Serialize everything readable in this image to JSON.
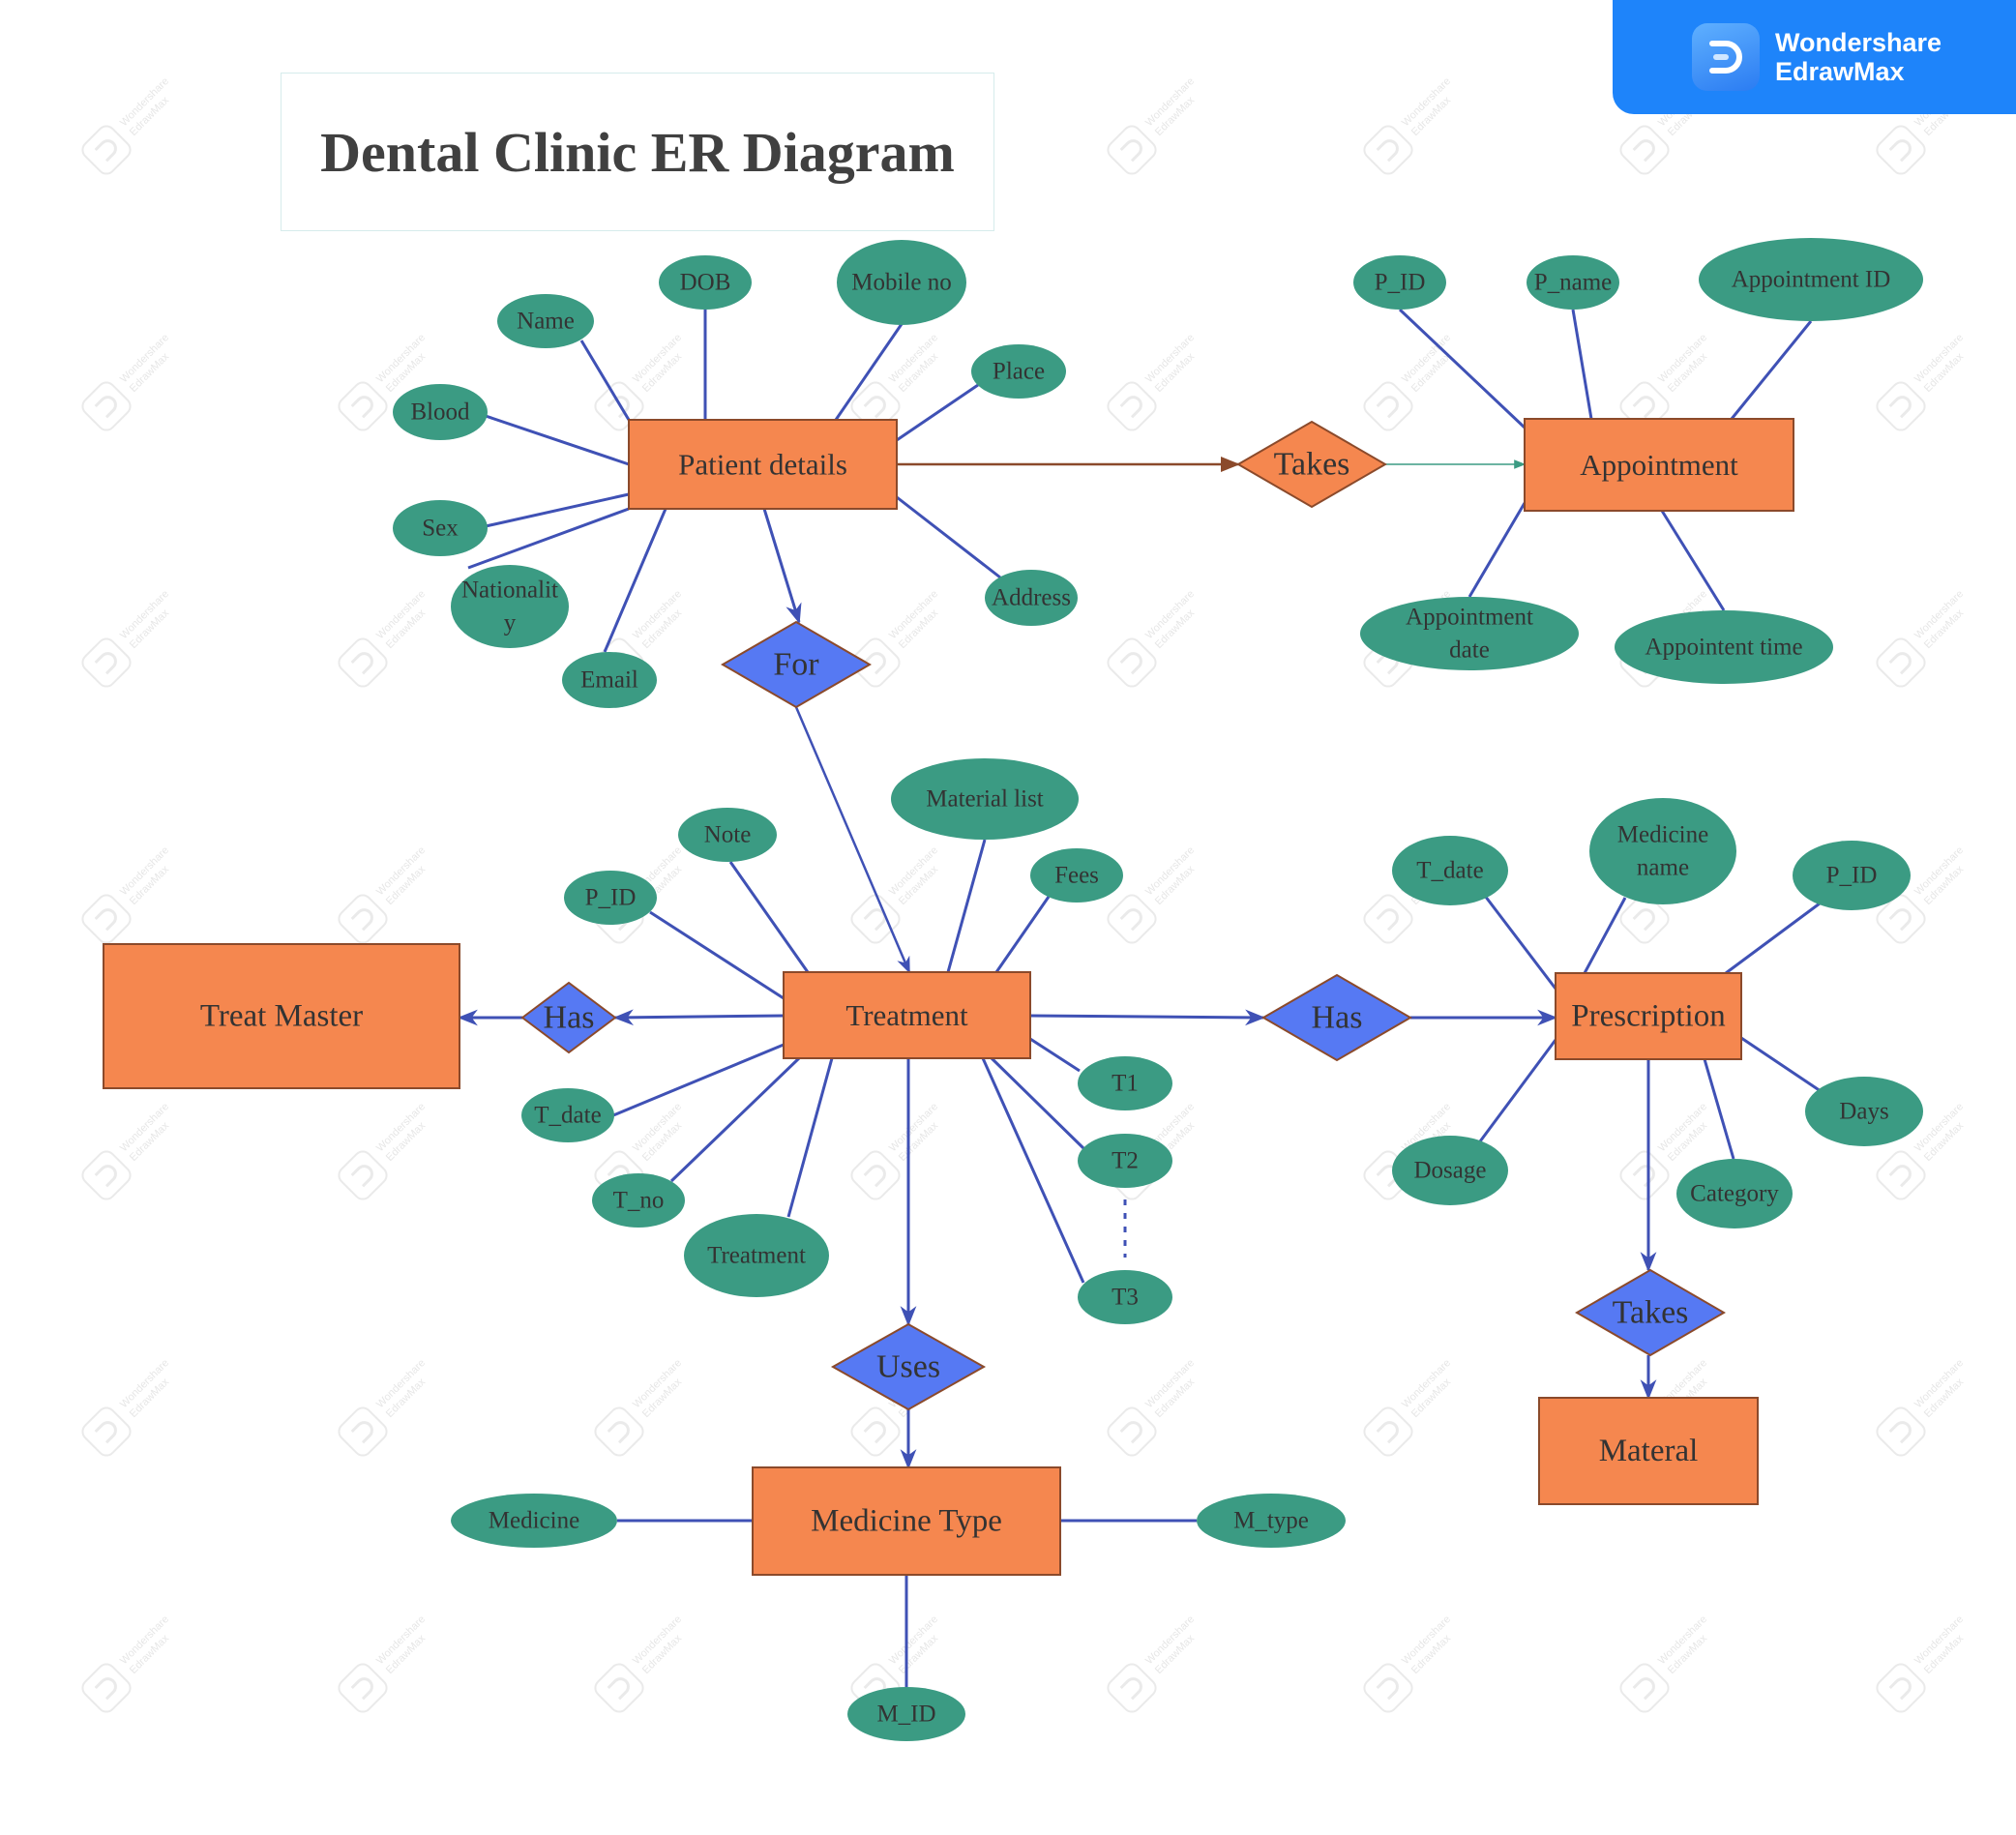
{
  "title": "Dental Clinic ER Diagram",
  "brand": {
    "line1": "Wondershare",
    "line2": "EdrawMax",
    "icon": "edrawmax-logo-icon",
    "watermark_line1": "Wondershare",
    "watermark_line2": "EdrawMax"
  },
  "colors": {
    "entity_fill": "#f5874f",
    "entity_stroke": "#8b4a2b",
    "attribute_fill": "#3b9b83",
    "relationship_fill": "#5679f3",
    "relationship_alt_fill": "#f5874f",
    "connector": "#3f51b5",
    "text": "#333333",
    "brand_bg": "#1e84fa"
  },
  "entities": [
    {
      "id": "patient",
      "label": "Patient details"
    },
    {
      "id": "appointment",
      "label": "Appointment"
    },
    {
      "id": "treatment",
      "label": "Treatment"
    },
    {
      "id": "treatmaster",
      "label": "Treat Master"
    },
    {
      "id": "prescription",
      "label": "Prescription"
    },
    {
      "id": "material",
      "label": "Materal"
    },
    {
      "id": "medtype",
      "label": "Medicine Type"
    }
  ],
  "relationships": [
    {
      "id": "takes1",
      "label": "Takes",
      "from": "patient",
      "to": "appointment",
      "style": "alt"
    },
    {
      "id": "for",
      "label": "For",
      "from": "patient",
      "to": "treatment"
    },
    {
      "id": "has1",
      "label": "Has",
      "from": "treatment",
      "to": "treatmaster"
    },
    {
      "id": "has2",
      "label": "Has",
      "from": "treatment",
      "to": "prescription"
    },
    {
      "id": "uses",
      "label": "Uses",
      "from": "treatment",
      "to": "medtype"
    },
    {
      "id": "takes2",
      "label": "Takes",
      "from": "prescription",
      "to": "material"
    }
  ],
  "attributes": [
    {
      "id": "p_name",
      "label": "Name",
      "entity": "patient"
    },
    {
      "id": "p_dob",
      "label": "DOB",
      "entity": "patient"
    },
    {
      "id": "p_mobile",
      "label": "Mobile no",
      "entity": "patient"
    },
    {
      "id": "p_place",
      "label": "Place",
      "entity": "patient"
    },
    {
      "id": "p_blood",
      "label": "Blood",
      "entity": "patient"
    },
    {
      "id": "p_sex",
      "label": "Sex",
      "entity": "patient"
    },
    {
      "id": "p_nat",
      "label": [
        "Nationalit",
        "y"
      ],
      "entity": "patient"
    },
    {
      "id": "p_email",
      "label": "Email",
      "entity": "patient"
    },
    {
      "id": "p_address",
      "label": "Address",
      "entity": "patient"
    },
    {
      "id": "a_pid",
      "label": "P_ID",
      "entity": "appointment"
    },
    {
      "id": "a_pname",
      "label": "P_name",
      "entity": "appointment"
    },
    {
      "id": "a_aid",
      "label": "Appointment ID",
      "entity": "appointment"
    },
    {
      "id": "a_date",
      "label": [
        "Appointment",
        "date"
      ],
      "entity": "appointment"
    },
    {
      "id": "a_time",
      "label": "Appointent time",
      "entity": "appointment"
    },
    {
      "id": "t_note",
      "label": "Note",
      "entity": "treatment"
    },
    {
      "id": "t_pid",
      "label": "P_ID",
      "entity": "treatment"
    },
    {
      "id": "t_matlist",
      "label": "Material list",
      "entity": "treatment"
    },
    {
      "id": "t_fees",
      "label": "Fees",
      "entity": "treatment"
    },
    {
      "id": "t_tdate",
      "label": "T_date",
      "entity": "treatment"
    },
    {
      "id": "t_tno",
      "label": "T_no",
      "entity": "treatment"
    },
    {
      "id": "t_treatment",
      "label": "Treatment",
      "entity": "treatment"
    },
    {
      "id": "t_t1",
      "label": "T1",
      "entity": "treatment"
    },
    {
      "id": "t_t2",
      "label": "T2",
      "entity": "treatment"
    },
    {
      "id": "t_t3",
      "label": "T3",
      "entity": "treatment"
    },
    {
      "id": "r_tdate",
      "label": "T_date",
      "entity": "prescription"
    },
    {
      "id": "r_medname",
      "label": [
        "Medicine",
        "name"
      ],
      "entity": "prescription"
    },
    {
      "id": "r_pid",
      "label": "P_ID",
      "entity": "prescription"
    },
    {
      "id": "r_dosage",
      "label": "Dosage",
      "entity": "prescription"
    },
    {
      "id": "r_category",
      "label": "Category",
      "entity": "prescription"
    },
    {
      "id": "r_days",
      "label": "Days",
      "entity": "prescription"
    },
    {
      "id": "m_medicine",
      "label": "Medicine",
      "entity": "medtype"
    },
    {
      "id": "m_mtype",
      "label": "M_type",
      "entity": "medtype"
    },
    {
      "id": "m_mid",
      "label": "M_ID",
      "entity": "medtype"
    }
  ]
}
